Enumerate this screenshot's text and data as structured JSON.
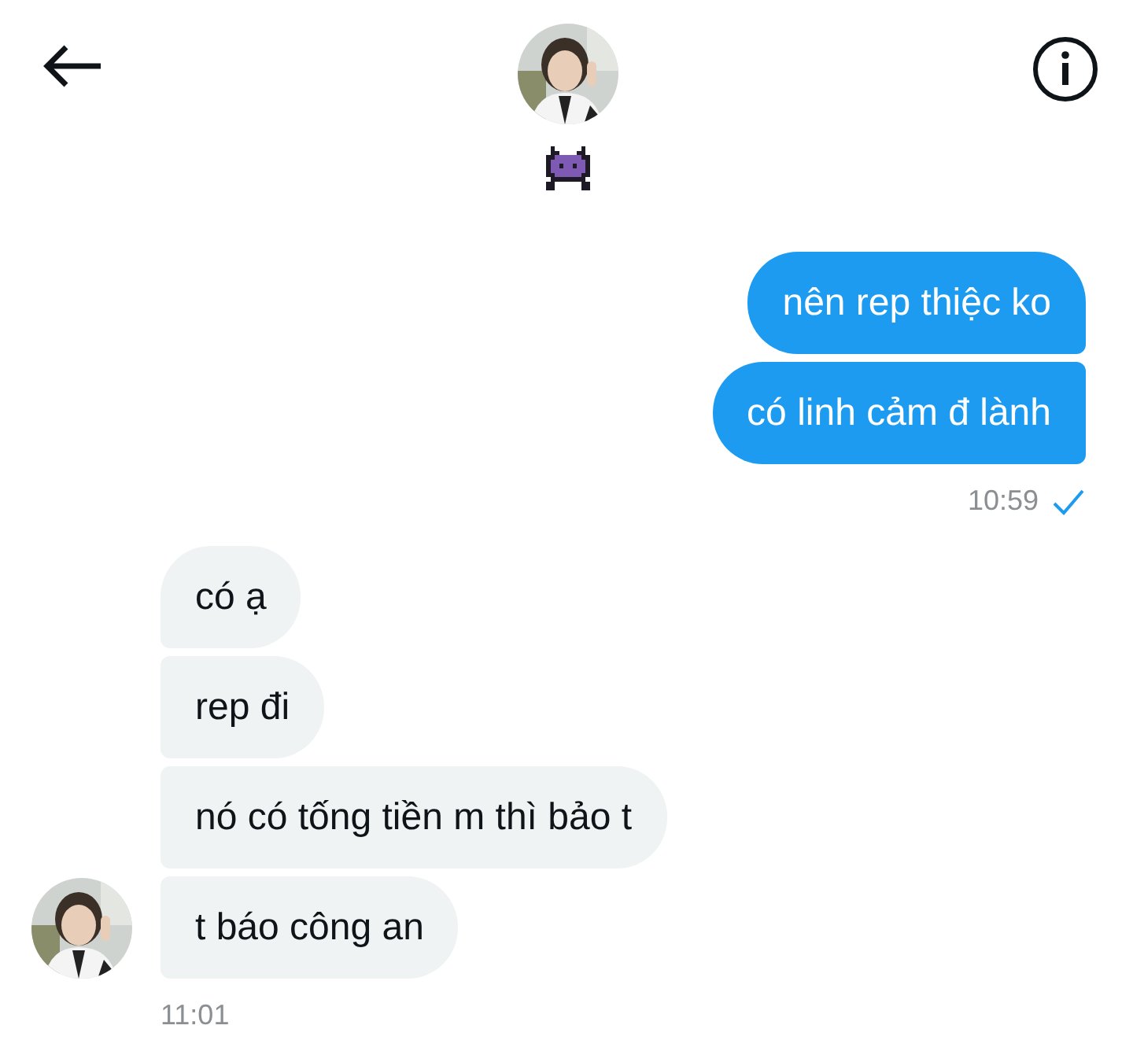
{
  "groups": [
    {
      "kind": "sent",
      "messages": [
        "nên rep thiệc ko",
        "có linh cảm đ lành"
      ],
      "time": "10:59"
    },
    {
      "kind": "received",
      "messages": [
        "có ạ",
        "rep đi",
        "nó có tống tiền m thì bảo t",
        "t báo công an"
      ],
      "time": "11:01"
    }
  ]
}
